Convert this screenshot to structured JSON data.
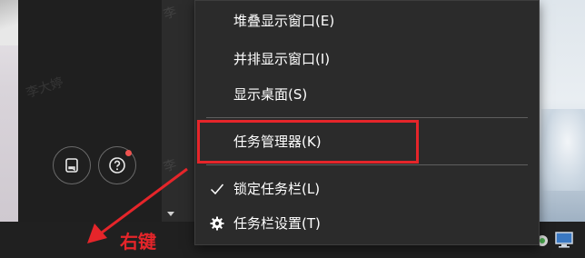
{
  "watermarks": [
    "李大婷",
    "李",
    "李"
  ],
  "context_menu": {
    "items": [
      {
        "label": "堆叠显示窗口(E)",
        "mark": ""
      },
      {
        "label": "并排显示窗口(I)",
        "mark": ""
      },
      {
        "label": "显示桌面(S)",
        "mark": ""
      },
      {
        "label": "任务管理器(K)",
        "mark": ""
      },
      {
        "label": "锁定任务栏(L)",
        "mark": "checkmark-icon"
      },
      {
        "label": "任务栏设置(T)",
        "mark": "gear-icon"
      }
    ],
    "highlighted_item": "任务管理器(K)"
  },
  "annotation": {
    "label": "右键",
    "color": "#e5252a"
  },
  "left_panel": {
    "buttons": [
      {
        "name": "feedback-icon"
      },
      {
        "name": "help-icon",
        "badge": true
      }
    ]
  },
  "colors": {
    "menu_bg": "#2b2b2b",
    "taskbar_bg": "#202020",
    "accent_red": "#e5252a"
  }
}
